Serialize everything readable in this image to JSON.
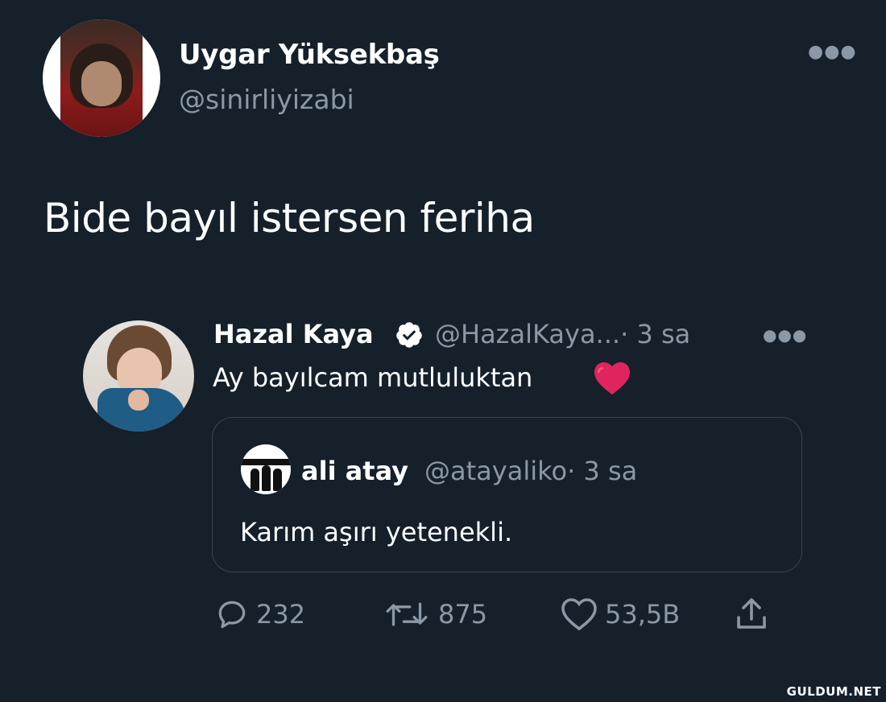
{
  "tweet": {
    "author": {
      "name": "Uygar Yüksekbaş",
      "handle": "@sinirliyizabi"
    },
    "text": "Bide bayıl istersen feriha",
    "more_icon": "ellipsis-icon"
  },
  "quoted": {
    "author": {
      "name": "Hazal Kaya",
      "handle": "@HazalKaya...",
      "verified": true
    },
    "time": "· 3 sa",
    "text": "Ay bayılcam mutluluktan",
    "emoji": "red-heart",
    "nested": {
      "author": {
        "name": "ali atay",
        "handle": "@atayaliko"
      },
      "time": "· 3 sa",
      "text": "Karım aşırı yetenekli."
    }
  },
  "actions": {
    "replies": "232",
    "retweets": "875",
    "likes": "53,5B"
  },
  "watermark": "GULDUM.NET",
  "colors": {
    "background": "#15202b",
    "secondary_text": "#8b98a5",
    "border": "#38444d",
    "heart": "#e0245e"
  }
}
